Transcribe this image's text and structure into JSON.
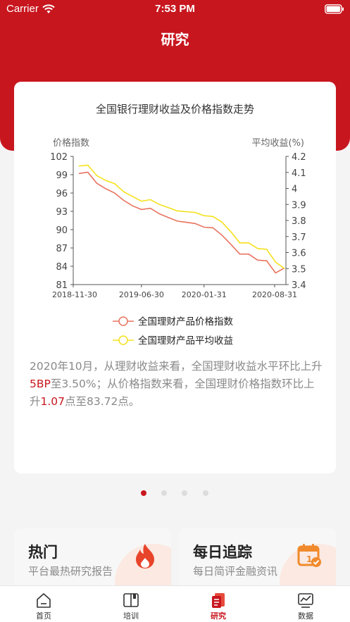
{
  "status_bar": {
    "carrier": "Carrier",
    "time": "7:53 PM"
  },
  "nav": {
    "title": "研究"
  },
  "chart_data": {
    "type": "line",
    "title": "全国银行理财收益及价格指数走势",
    "y_left_label": "价格指数",
    "y_right_label": "平均收益(%)",
    "x_ticks": [
      "2018-11-30",
      "2019-06-30",
      "2020-01-31",
      "2020-08-31"
    ],
    "y_left_ticks": [
      "102",
      "99",
      "96",
      "93",
      "90",
      "87",
      "84",
      "81"
    ],
    "y_left_range": [
      81,
      102
    ],
    "y_right_ticks": [
      "4.2",
      "4.1",
      "4",
      "3.9",
      "3.8",
      "3.7",
      "3.6",
      "3.5",
      "3.4"
    ],
    "y_right_range": [
      3.4,
      4.2
    ],
    "x": [
      "2018-11",
      "2018-12",
      "2019-01",
      "2019-02",
      "2019-03",
      "2019-04",
      "2019-05",
      "2019-06",
      "2019-07",
      "2019-08",
      "2019-09",
      "2019-10",
      "2019-11",
      "2019-12",
      "2020-01",
      "2020-02",
      "2020-03",
      "2020-04",
      "2020-05",
      "2020-06",
      "2020-07",
      "2020-08",
      "2020-09",
      "2020-10"
    ],
    "series": [
      {
        "name": "全国理财产品价格指数",
        "axis": "left",
        "color": "#e8735f",
        "values": [
          99.2,
          99.4,
          97.6,
          96.7,
          96.0,
          94.8,
          93.9,
          93.3,
          93.5,
          92.6,
          92.0,
          91.4,
          91.2,
          91.0,
          90.4,
          90.3,
          89.1,
          87.6,
          86.0,
          86.0,
          85.0,
          84.9,
          82.9,
          83.72
        ]
      },
      {
        "name": "全国理财产品平均收益",
        "axis": "right",
        "color": "#f5e11d",
        "values": [
          4.14,
          4.145,
          4.08,
          4.05,
          4.03,
          3.98,
          3.95,
          3.92,
          3.93,
          3.9,
          3.88,
          3.86,
          3.855,
          3.85,
          3.83,
          3.825,
          3.79,
          3.73,
          3.66,
          3.66,
          3.625,
          3.62,
          3.54,
          3.5
        ]
      }
    ]
  },
  "summary": {
    "part1": "2020年10月，从理财收益来看，全国理财收益水平环比上升",
    "bp": "5BP",
    "part2": "至3.50%；从价格指数来看，全国理财价格指数环比上升",
    "pts": "1.07",
    "part3": "点至83.72点。"
  },
  "tiles": [
    {
      "title": "热门",
      "subtitle": "平台最热研究报告",
      "icon": "flame-icon",
      "color": "#e8442a"
    },
    {
      "title": "每日追踪",
      "subtitle": "每日简评金融资讯",
      "icon": "calendar-check-icon",
      "color": "#f08a2c"
    }
  ],
  "tabs": [
    {
      "label": "首页",
      "icon": "home-icon"
    },
    {
      "label": "培训",
      "icon": "book-icon"
    },
    {
      "label": "研究",
      "icon": "research-icon",
      "active": true
    },
    {
      "label": "数据",
      "icon": "chart-icon"
    }
  ],
  "colors": {
    "brand": "#c8161e"
  }
}
